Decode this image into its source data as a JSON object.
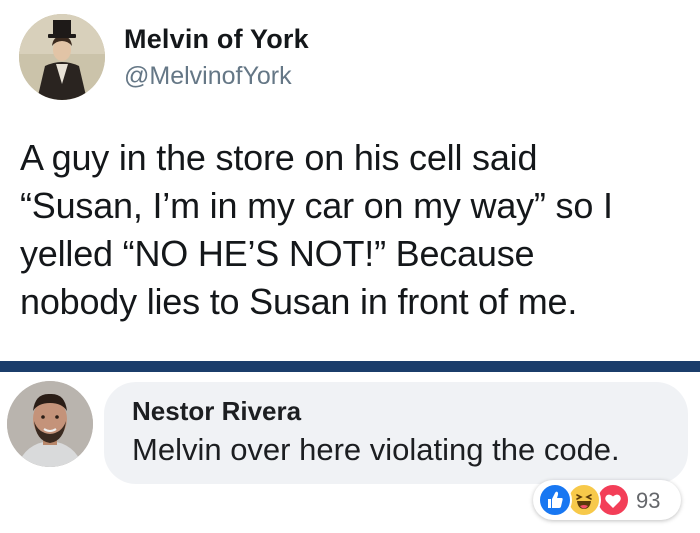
{
  "tweet": {
    "author_name": "Melvin of York",
    "author_handle": "@MelvinofYork",
    "text": "A guy in the store on his cell said\n“Susan, I’m in my car on my way” so I\nyelled “NO HE’S NOT!” Because\nnobody lies to Susan in front of me."
  },
  "comment": {
    "author_name": "Nestor Rivera",
    "text": "Melvin over here violating the code."
  },
  "reactions": {
    "icons": [
      "like-icon",
      "haha-icon",
      "love-icon"
    ],
    "count": "93"
  },
  "colors": {
    "divider": "#1b3d6b",
    "bubble": "#f0f2f5",
    "handle": "#657786",
    "like": "#1877f2",
    "haha": "#f7c94a",
    "love": "#f33e58"
  }
}
